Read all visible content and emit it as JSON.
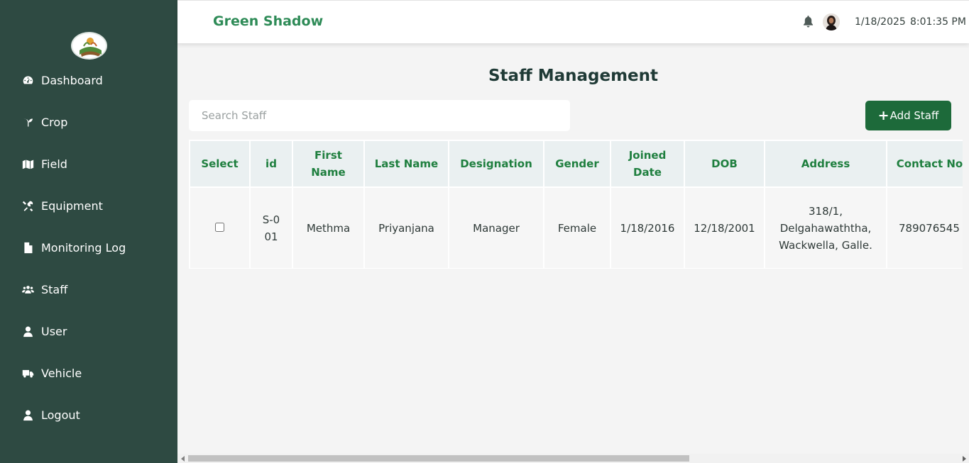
{
  "app": {
    "brand": "Green Shadow"
  },
  "sidebar": {
    "items": [
      {
        "label": "Dashboard",
        "icon": "dashboard-gauge-icon"
      },
      {
        "label": "Crop",
        "icon": "seedling-icon"
      },
      {
        "label": "Field",
        "icon": "map-icon"
      },
      {
        "label": "Equipment",
        "icon": "tools-icon"
      },
      {
        "label": "Monitoring Log",
        "icon": "file-icon"
      },
      {
        "label": "Staff",
        "icon": "users-icon"
      },
      {
        "label": "User",
        "icon": "user-icon"
      },
      {
        "label": "Vehicle",
        "icon": "truck-icon"
      },
      {
        "label": "Logout",
        "icon": "user-icon"
      }
    ]
  },
  "header": {
    "date": "1/18/2025",
    "time": "8:01:35 PM"
  },
  "main": {
    "title": "Staff Management",
    "search_placeholder": "Search Staff",
    "add_button": "Add Staff",
    "add_button_icon": "+",
    "table": {
      "columns": [
        "Select",
        "id",
        "First Name",
        "Last Name",
        "Designation",
        "Gender",
        "Joined Date",
        "DOB",
        "Address",
        "Contact No"
      ],
      "rows": [
        {
          "id": "S-001",
          "first_name": "Methma",
          "last_name": "Priyanjana",
          "designation": "Manager",
          "gender": "Female",
          "joined_date": "1/18/2016",
          "dob": "12/18/2001",
          "address": "318/1, Delgahawaththa, Wackwella, Galle.",
          "contact": "789076545"
        }
      ]
    }
  },
  "colors": {
    "sidebar_bg": "#2e4a42",
    "brand": "#2e8b57",
    "accent_button": "#1d6a3a",
    "table_header_text": "#1f7f3f"
  }
}
